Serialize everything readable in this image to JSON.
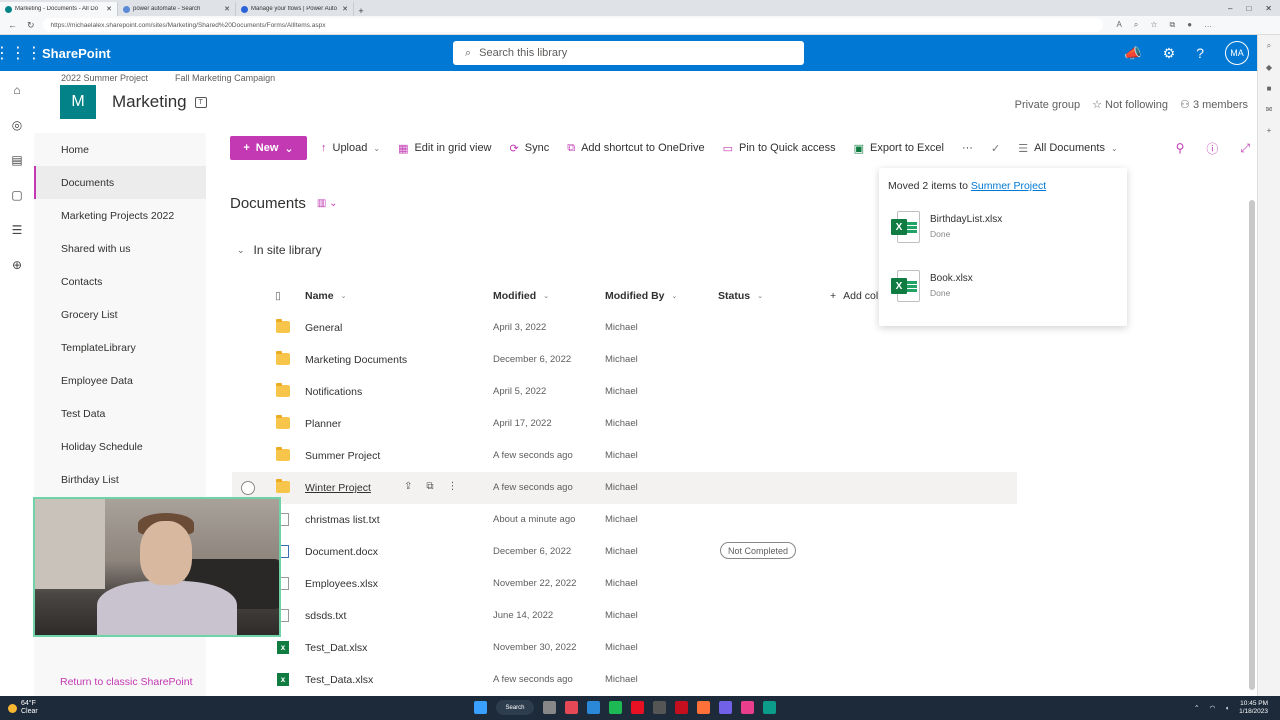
{
  "browser": {
    "tabs": [
      {
        "title": "Marketing - Documents - All Do",
        "active": true
      },
      {
        "title": "power automate - Search",
        "active": false
      },
      {
        "title": "Manage your flows | Power Auto",
        "active": false
      }
    ],
    "url": "https://michaelalex.sharepoint.com/sites/Marketing/Shared%20Documents/Forms/AllItems.aspx"
  },
  "suitebar": {
    "brand": "SharePoint",
    "search_placeholder": "Search this library",
    "avatar_initials": "MA",
    "color": "#0078d4"
  },
  "hub": {
    "links": [
      "2022 Summer Project",
      "Fall Marketing Campaign"
    ]
  },
  "site": {
    "logo_letter": "M",
    "logo_color": "#038387",
    "title": "Marketing",
    "privacy": "Private group",
    "follow": "Not following",
    "members": "3 members"
  },
  "leftnav": {
    "items": [
      {
        "label": "Home",
        "selected": false
      },
      {
        "label": "Documents",
        "selected": true
      },
      {
        "label": "Marketing Projects 2022",
        "selected": false
      },
      {
        "label": "Shared with us",
        "selected": false
      },
      {
        "label": "Contacts",
        "selected": false
      },
      {
        "label": "Grocery List",
        "selected": false
      },
      {
        "label": "TemplateLibrary",
        "selected": false
      },
      {
        "label": "Employee Data",
        "selected": false
      },
      {
        "label": "Test Data",
        "selected": false
      },
      {
        "label": "Holiday Schedule",
        "selected": false
      },
      {
        "label": "Birthday List",
        "selected": false
      }
    ],
    "classic_link": "Return to classic SharePoint"
  },
  "commandbar": {
    "new_label": "New",
    "upload_label": "Upload",
    "grid_label": "Edit in grid view",
    "sync_label": "Sync",
    "shortcut_label": "Add shortcut to OneDrive",
    "pin_label": "Pin to Quick access",
    "export_label": "Export to Excel",
    "more_label": "···",
    "view_label": "All Documents",
    "accent": "#c239b3"
  },
  "library": {
    "title": "Documents",
    "group_header": "In site library",
    "columns": {
      "name": "Name",
      "modified": "Modified",
      "modified_by": "Modified By",
      "status": "Status",
      "add_column": "Add col"
    },
    "rows": [
      {
        "name": "General",
        "type": "folder",
        "modified": "April 3, 2022",
        "modified_by": "Michael",
        "status": ""
      },
      {
        "name": "Marketing Documents",
        "type": "folder",
        "modified": "December 6, 2022",
        "modified_by": "Michael",
        "status": ""
      },
      {
        "name": "Notifications",
        "type": "folder",
        "modified": "April 5, 2022",
        "modified_by": "Michael",
        "status": ""
      },
      {
        "name": "Planner",
        "type": "folder",
        "modified": "April 17, 2022",
        "modified_by": "Michael",
        "status": ""
      },
      {
        "name": "Summer Project",
        "type": "folder",
        "modified": "A few seconds ago",
        "modified_by": "Michael",
        "status": ""
      },
      {
        "name": "Winter Project",
        "type": "folder",
        "modified": "A few seconds ago",
        "modified_by": "Michael",
        "status": "",
        "hover": true
      },
      {
        "name": "christmas list.txt",
        "type": "txt",
        "modified": "About a minute ago",
        "modified_by": "Michael",
        "status": ""
      },
      {
        "name": "Document.docx",
        "type": "word",
        "modified": "December 6, 2022",
        "modified_by": "Michael",
        "status": "Not Completed"
      },
      {
        "name": "Employees.xlsx",
        "type": "txt",
        "modified": "November 22, 2022",
        "modified_by": "Michael",
        "status": ""
      },
      {
        "name": "sdsds.txt",
        "type": "txt",
        "modified": "June 14, 2022",
        "modified_by": "Michael",
        "status": ""
      },
      {
        "name": "Test_Dat.xlsx",
        "type": "excel",
        "modified": "November 30, 2022",
        "modified_by": "Michael",
        "status": ""
      },
      {
        "name": "Test_Data.xlsx",
        "type": "excel",
        "modified": "A few seconds ago",
        "modified_by": "Michael",
        "status": ""
      }
    ]
  },
  "toast": {
    "message_prefix": "Moved 2 items to",
    "target": "Summer Project",
    "items": [
      {
        "name": "BirthdayList.xlsx",
        "status": "Done"
      },
      {
        "name": "Book.xlsx",
        "status": "Done"
      }
    ]
  },
  "taskbar": {
    "temp": "64°F",
    "weather": "Clear",
    "search_label": "Search",
    "time": "10:45 PM",
    "date": "1/18/2023"
  }
}
